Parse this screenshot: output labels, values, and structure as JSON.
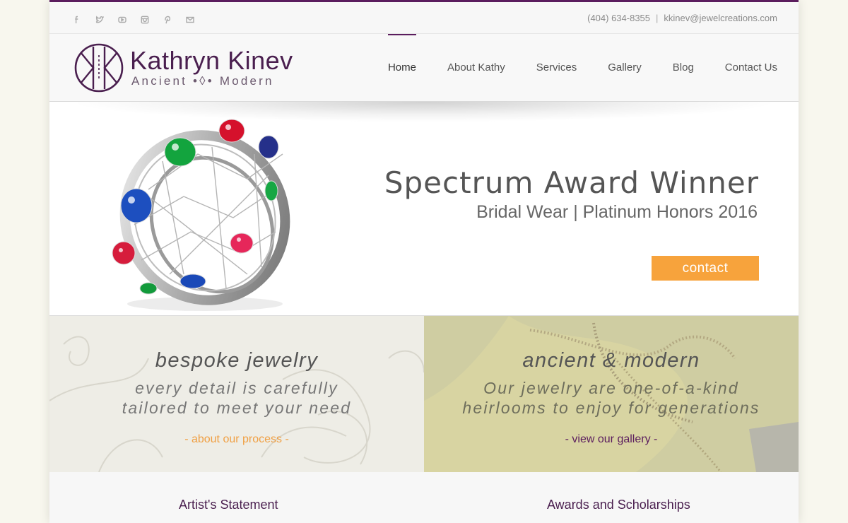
{
  "topbar": {
    "social_icons": [
      "facebook-icon",
      "twitter-icon",
      "youtube-icon",
      "instagram-icon",
      "pinterest-icon",
      "email-icon"
    ],
    "phone": "(404) 634-8355",
    "separator": "|",
    "email": "kkinev@jewelcreations.com"
  },
  "logo": {
    "name": "Kathryn Kinev",
    "tagline": "Ancient •◊• Modern"
  },
  "nav": {
    "items": [
      "Home",
      "About Kathy",
      "Services",
      "Gallery",
      "Blog",
      "Contact Us"
    ],
    "active": "Home"
  },
  "hero": {
    "title": "Spectrum Award Winner",
    "subtitle": "Bridal Wear | Platinum Honors 2016",
    "button": "contact"
  },
  "promos": [
    {
      "title": "bespoke jewelry",
      "line1": "every detail is carefully",
      "line2": "tailored to meet your need",
      "link": "- about our process -"
    },
    {
      "title": "ancient & modern",
      "line1": "Our jewelry are one-of-a-kind",
      "line2": "heirlooms to enjoy for generations",
      "link": "- view our gallery -"
    }
  ],
  "bottom": {
    "left_heading": "Artist's Statement",
    "right_heading": "Awards and Scholarships"
  },
  "colors": {
    "brand_purple": "#5b1d5e",
    "accent_orange": "#f7a33c"
  }
}
